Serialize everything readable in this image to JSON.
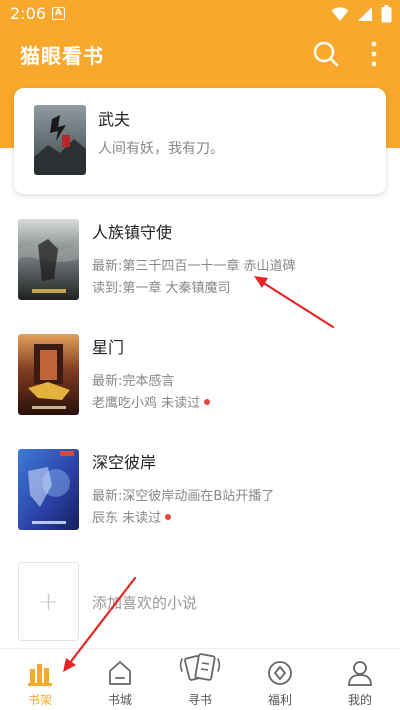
{
  "status_bar": {
    "time": "2:06",
    "notice_letter": "A"
  },
  "header": {
    "title": "猫眼看书"
  },
  "featured": {
    "title": "武夫",
    "description": "人间有妖，我有刀。"
  },
  "books": [
    {
      "title": "人族镇守使",
      "latest": "最新:第三千四百一十一章 赤山道碑",
      "progress": "读到:第一章 大秦镇魔司"
    },
    {
      "title": "星门",
      "latest": "最新:完本感言",
      "progress": "老鹰吃小鸡  未读过"
    },
    {
      "title": "深空彼岸",
      "latest": "最新:深空彼岸动画在B站开播了",
      "progress": "辰东  未读过"
    }
  ],
  "add_item": {
    "label": "添加喜欢的小说",
    "icon": "plus-icon"
  },
  "nav": {
    "items": [
      {
        "label": "书架",
        "icon": "bookshelf-icon",
        "active": true
      },
      {
        "label": "书城",
        "icon": "bookstore-icon",
        "active": false
      },
      {
        "label": "寻书",
        "icon": "find-book-icon",
        "active": false
      },
      {
        "label": "福利",
        "icon": "welfare-icon",
        "active": false
      },
      {
        "label": "我的",
        "icon": "profile-icon",
        "active": false
      }
    ]
  },
  "colors": {
    "accent": "#f8a92b",
    "annotation": "#e52424",
    "unread_dot": "#e94040"
  }
}
